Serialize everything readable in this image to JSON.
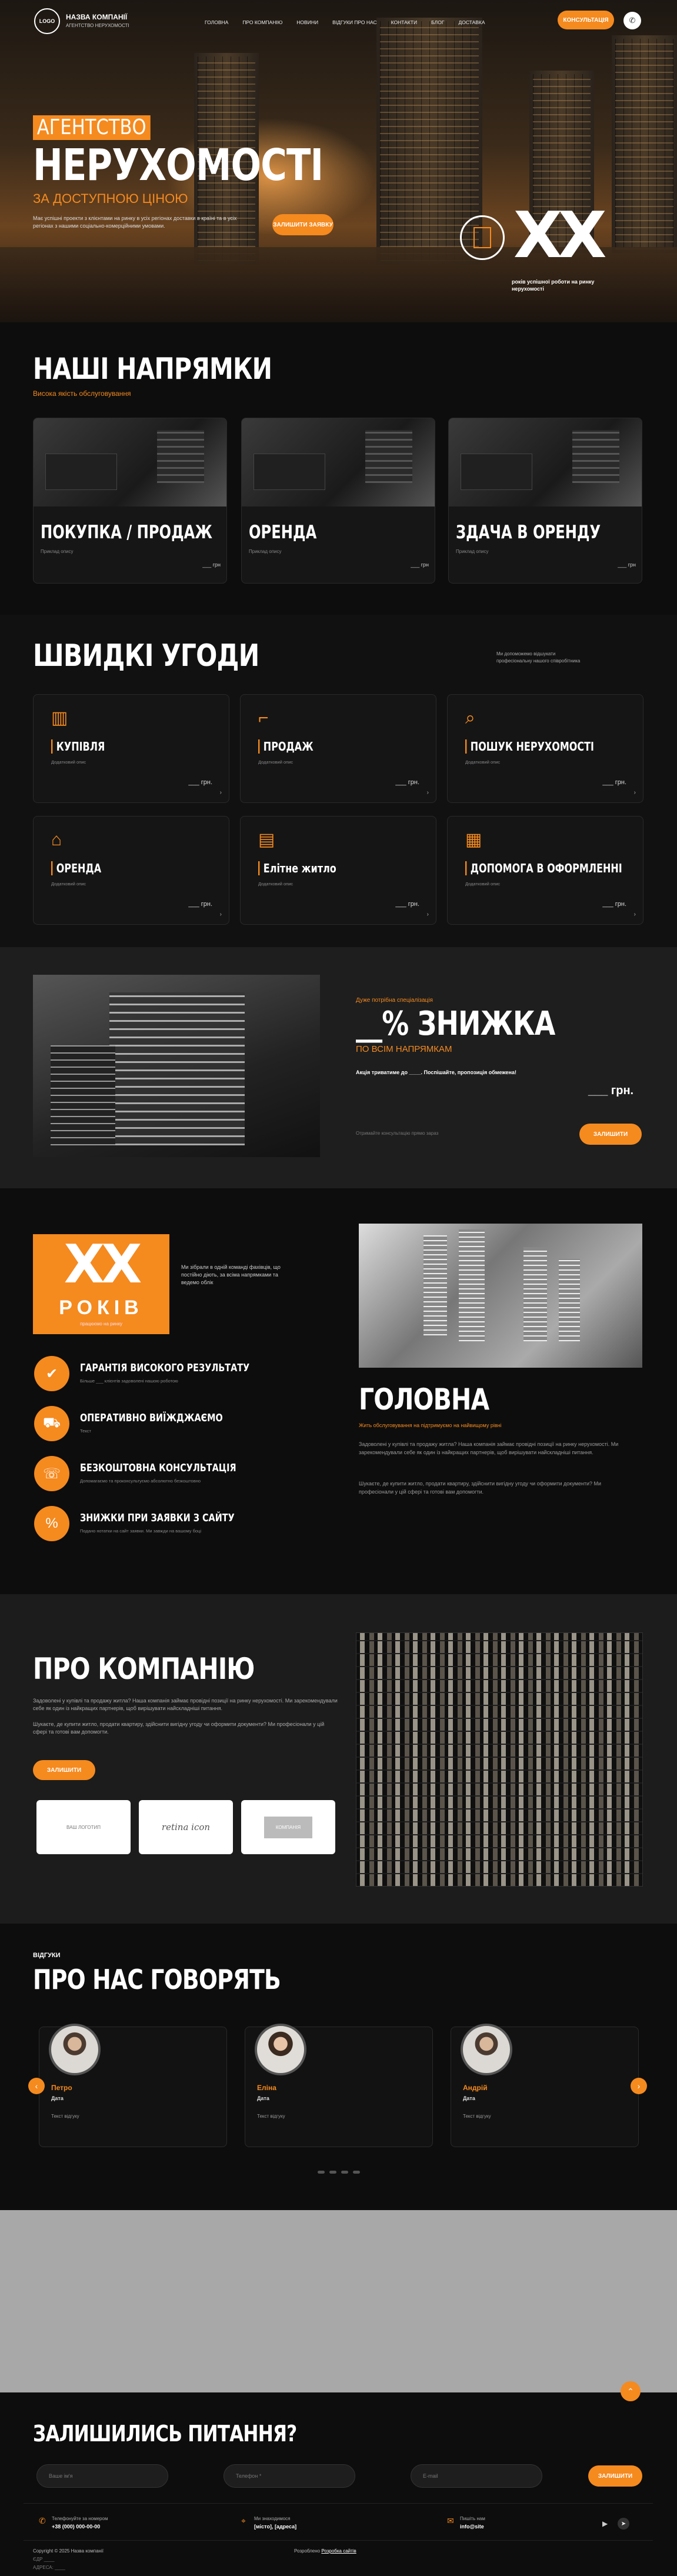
{
  "header": {
    "logo": "LOGO",
    "company": "НАЗВА КОМПАНІЇ",
    "tagline": "АГЕНТСТВО НЕРУХОМОСТІ",
    "menu": [
      "ГОЛОВНА",
      "ПРО КОМПАНІЮ",
      "НОВИНИ",
      "ВІДГУКИ ПРО НАС",
      "КОНТАКТИ",
      "БЛОГ",
      "ДОСТАВКА"
    ],
    "cta": "КОНСУЛЬТАЦІЯ"
  },
  "hero": {
    "kicker": "АГЕНТСТВО",
    "title": "НЕРУХОМОСТІ",
    "subtitle": "ЗА ДОСТУПНОЮ ЦІНОЮ",
    "desc": "Має успішні проекти з клієнтами на ринку в усіх регіонах доставки в країні та в усіх регіонах з нашими соціально-комерційними умовами.",
    "button": "ЗАЛИШИТИ ЗАЯВКУ",
    "years": "XX",
    "years_label": "років успішної роботи на ринку нерухомості"
  },
  "directions": {
    "title": "НАШІ НАПРЯМКИ",
    "subtitle": "Висока якість обслуговування",
    "cards": [
      {
        "title": "ПОКУПКА / ПРОДАЖ",
        "sub": "Приклад опису",
        "price": "___ грн"
      },
      {
        "title": "ОРЕНДА",
        "sub": "Приклад опису",
        "price": "___ грн"
      },
      {
        "title": "ЗДАЧА В ОРЕНДУ",
        "sub": "Приклад опису",
        "price": "___ грн"
      }
    ]
  },
  "deals": {
    "title": "ШВИДКІ УГОДИ",
    "side": "Ми допоможемо відшукати професіональну нашого співробітника",
    "items": [
      {
        "icon": "building-icon",
        "label": "КУПІВЛЯ",
        "sub": "Додатковий опис",
        "price": "___ грн."
      },
      {
        "icon": "crane-icon",
        "label": "ПРОДАЖ",
        "sub": "Додатковий опис",
        "price": "___ грн."
      },
      {
        "icon": "magnifier-icon",
        "label": "ПОШУК НЕРУХОМОСТІ",
        "sub": "Додатковий опис",
        "price": "___ грн."
      },
      {
        "icon": "house-doc-icon",
        "label": "ОРЕНДА",
        "sub": "Додатковий опис",
        "price": "___ грн."
      },
      {
        "icon": "elite-building-icon",
        "label": "Елітне житло",
        "sub": "Додатковий опис",
        "price": "___ грн."
      },
      {
        "icon": "document-icon",
        "label": "ДОПОМОГА В ОФОРМЛЕННІ",
        "sub": "Додатковий опис",
        "price": "___ грн."
      }
    ]
  },
  "promo": {
    "kicker": "Дуже потрібна спеціалізація",
    "title": "__% ЗНИЖКА",
    "subtitle": "ПО ВСІМ НАПРЯМКАМ",
    "desc": "Акція триватиме до ____. Поспішайте, пропозиція обмежена!",
    "price": "___ грн.",
    "note": "Отримайте консультацію прямо зараз",
    "button": "ЗАЛИШИТИ"
  },
  "years": {
    "number": "XX",
    "word": "РОКІВ",
    "small": "працюємо на ринку",
    "desc": "Ми зібрали в одній команді фахівців, що постійно діють, за всіма напрямками та ведемо облік",
    "features": [
      {
        "icon": "check-icon",
        "title": "ГАРАНТІЯ ВИСОКОГО РЕЗУЛЬТАТУ",
        "sub": "Більше ___ клієнтів задоволені нашою роботою"
      },
      {
        "icon": "car-icon",
        "title": "ОПЕРАТИВНО ВИЇЖДЖАЄМО",
        "sub": "Текст"
      },
      {
        "icon": "consult-icon",
        "title": "БЕЗКОШТОВНА КОНСУЛЬТАЦІЯ",
        "sub": "Допомагаємо та проконсультуємо абсолютно безкоштовно"
      },
      {
        "icon": "percent-icon",
        "title": "ЗНИЖКИ ПРИ ЗАЯВКИ З САЙТУ",
        "sub": "Подано нотатки на сайт заявки. Ми завжди на вашому боці"
      }
    ],
    "main_title": "ГОЛОВНА",
    "main_kicker": "Жить обслуговування на підтримуємо на найвищому рівні",
    "main_p1": "Задоволені у купівлі та продажу житла? Наша компанія займає провідні позиції на ринку нерухомості. Ми зарекомендували себе як один із найкращих партнерів, щоб вирішувати найскладніші питання.",
    "main_p2": "Шукаєте, де купити житло, продати квартиру, здійснити вигідну угоду чи оформити документи? Ми професіонали у цій сфері та готові вам допомогти."
  },
  "about": {
    "title": "ПРО КОМПАНІЮ",
    "p1": "Задоволені у купівлі та продажу житла? Наша компанія займає провідні позиції на ринку нерухомості. Ми зарекомендували себе як один із найкращих партнерів, щоб вирішувати найскладніші питання.",
    "p2": "Шукаєте, де купити житло, продати квартиру, здійснити вигідну угоду чи оформити документи? Ми професіонали у цій сфері та готові вам допомогти.",
    "button": "ЗАЛИШИТИ",
    "partners": [
      "ВАШ ЛОГОТИП",
      "retina icon",
      "КОМПАНІЯ"
    ]
  },
  "reviews": {
    "kicker": "ВІДГУКИ",
    "title": "ПРО НАС ГОВОРЯТЬ",
    "items": [
      {
        "name": "Петро",
        "role": "Дата",
        "text": "Текст відгуку"
      },
      {
        "name": "Еліна",
        "role": "Дата",
        "text": "Текст відгуку"
      },
      {
        "name": "Андрій",
        "role": "Дата",
        "text": "Текст відгуку"
      }
    ]
  },
  "contact": {
    "title": "ЗАЛИШИЛИСЬ ПИТАННЯ?",
    "fields": [
      "Ваше ім'я",
      "Телефон *",
      "E-mail"
    ],
    "button": "ЗАЛИШИТИ",
    "phone_label": "Телефонуйте за номером",
    "phone": "+38 (000) 000-00-00",
    "address_label": "Ми знаходимося",
    "address": "[місто], [адреса]",
    "email_label": "Пишіть нам",
    "email": "info@site"
  },
  "footer": {
    "copy": "Copyright © 2025 Назва компанії",
    "made": "Розроблено",
    "link": "Розробка сайтів",
    "row1": "ЄДР ____",
    "row2": "АДРЕСА: ____",
    "row3": "ТЕЛЕФОН: ____"
  },
  "colors": {
    "accent": "#f58a1f",
    "bg": "#0d0d0d"
  }
}
